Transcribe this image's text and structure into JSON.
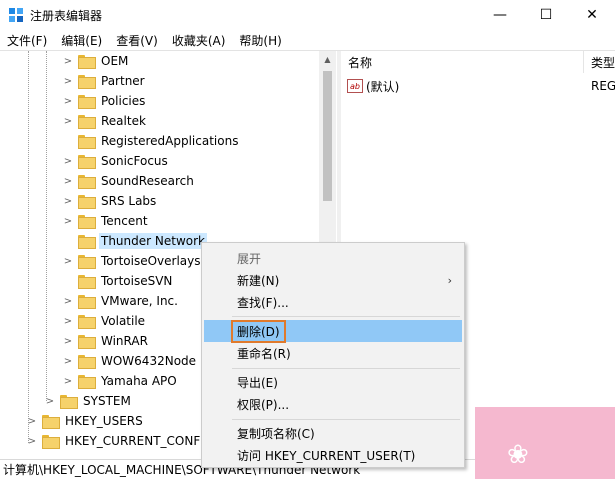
{
  "window": {
    "title": "注册表编辑器",
    "controls": {
      "minimize": "—",
      "maximize": "☐",
      "close": "✕"
    }
  },
  "menubar": [
    {
      "label": "文件(F)"
    },
    {
      "label": "编辑(E)"
    },
    {
      "label": "查看(V)"
    },
    {
      "label": "收藏夹(A)"
    },
    {
      "label": "帮助(H)"
    }
  ],
  "tree": {
    "items": [
      {
        "label": "OEM",
        "expandable": true
      },
      {
        "label": "Partner",
        "expandable": true
      },
      {
        "label": "Policies",
        "expandable": true
      },
      {
        "label": "Realtek",
        "expandable": true
      },
      {
        "label": "RegisteredApplications",
        "expandable": false
      },
      {
        "label": "SonicFocus",
        "expandable": true
      },
      {
        "label": "SoundResearch",
        "expandable": true
      },
      {
        "label": "SRS Labs",
        "expandable": true
      },
      {
        "label": "Tencent",
        "expandable": true
      },
      {
        "label": "Thunder Network",
        "expandable": false,
        "selected": true
      },
      {
        "label": "TortoiseOverlays",
        "expandable": true
      },
      {
        "label": "TortoiseSVN",
        "expandable": false
      },
      {
        "label": "VMware, Inc.",
        "expandable": true
      },
      {
        "label": "Volatile",
        "expandable": true
      },
      {
        "label": "WinRAR",
        "expandable": true
      },
      {
        "label": "WOW6432Node",
        "expandable": true
      },
      {
        "label": "Yamaha APO",
        "expandable": true
      }
    ],
    "system": {
      "label": "SYSTEM"
    },
    "roots": [
      {
        "label": "HKEY_USERS"
      },
      {
        "label": "HKEY_CURRENT_CONFIG"
      }
    ]
  },
  "list": {
    "columns": {
      "name": "名称",
      "type": "类型"
    },
    "rows": [
      {
        "icon": "ab",
        "name": "(默认)",
        "type": "REG"
      }
    ]
  },
  "context_menu": {
    "items": [
      {
        "label": "展开",
        "kind": "header"
      },
      {
        "label": "新建(N)",
        "submenu": "›"
      },
      {
        "label": "查找(F)..."
      },
      {
        "label": "删除(D)",
        "highlight": true
      },
      {
        "label": "重命名(R)"
      },
      {
        "label": "导出(E)"
      },
      {
        "label": "权限(P)..."
      },
      {
        "label": "复制项名称(C)"
      },
      {
        "label": "访问 HKEY_CURRENT_USER(T)"
      }
    ]
  },
  "statusbar": {
    "path": "计算机\\HKEY_LOCAL_MACHINE\\SOFTWARE\\Thunder Network"
  },
  "colors": {
    "selection": "#cce8ff",
    "menu_highlight": "#90c8f6",
    "delete_outline": "#e07a2c"
  }
}
